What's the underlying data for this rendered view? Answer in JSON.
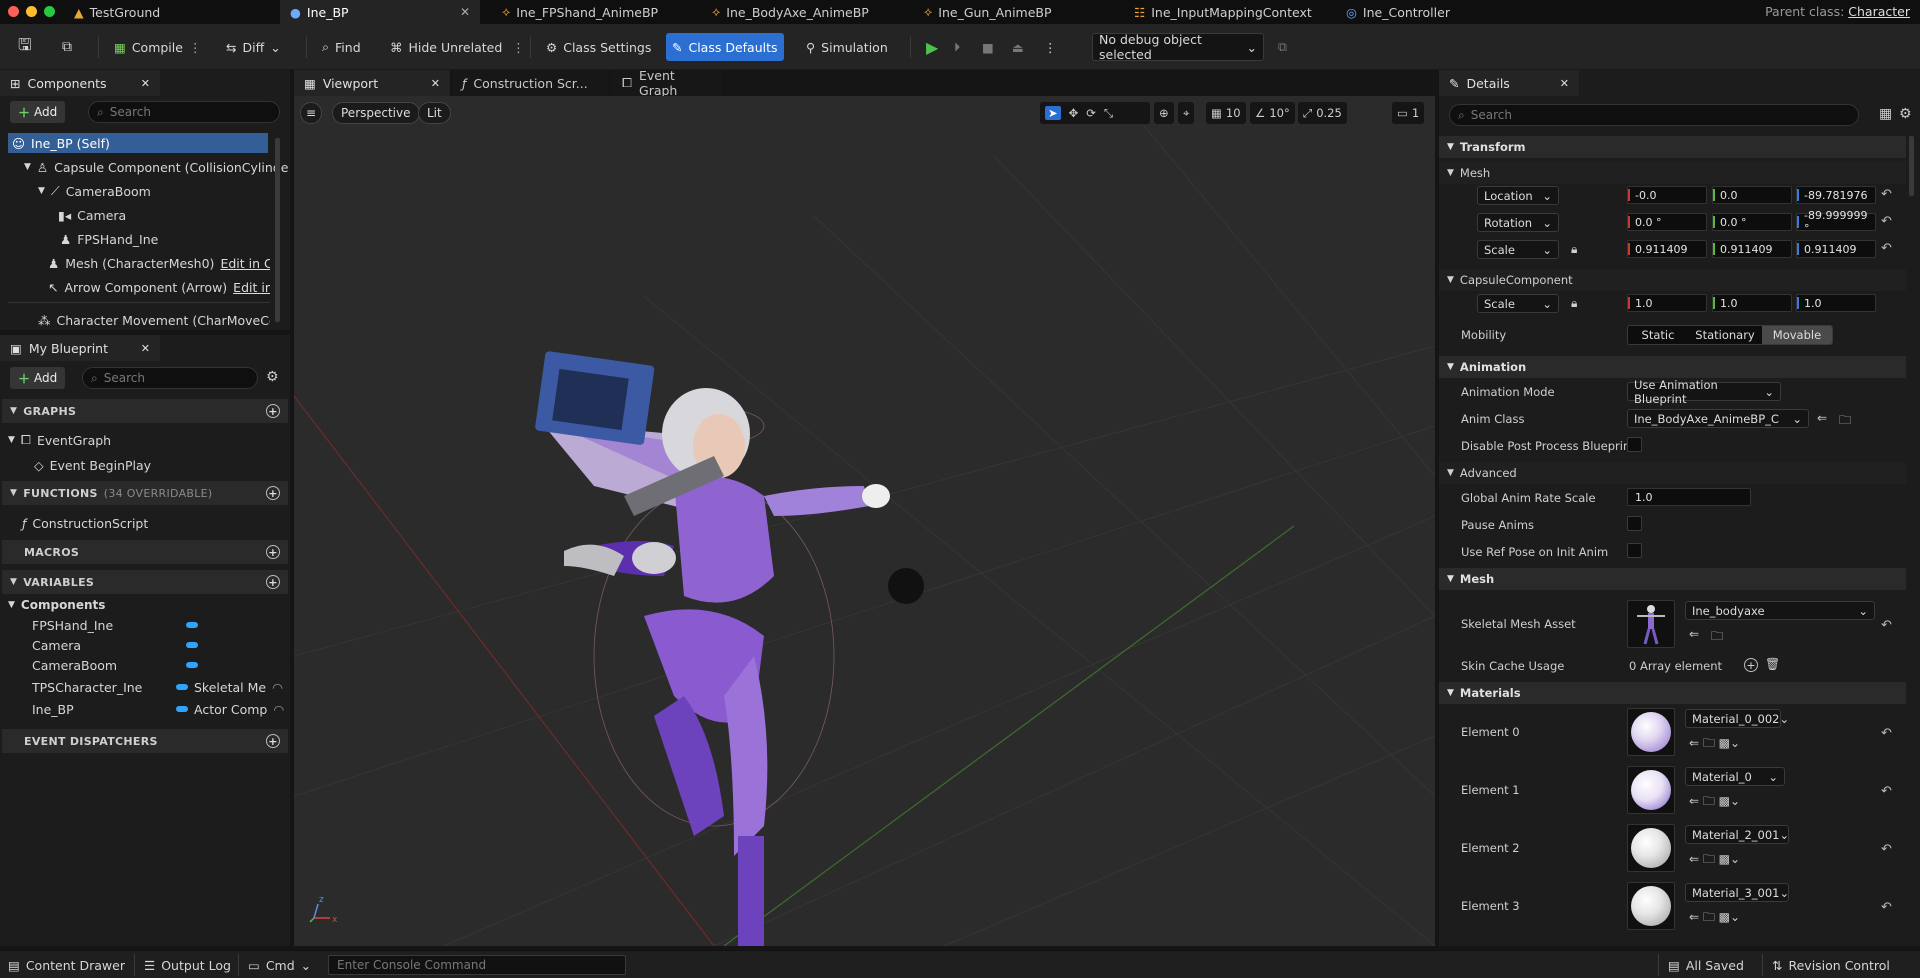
{
  "tabs": {
    "testground": "TestGround",
    "ine_bp": "Ine_BP",
    "fpshand": "Ine_FPShand_AnimeBP",
    "bodyaxe": "Ine_BodyAxe_AnimeBP",
    "gun": "Ine_Gun_AnimeBP",
    "input": "Ine_InputMappingContext",
    "controller": "Ine_Controller",
    "parent_label": "Parent class:",
    "parent_value": "Character"
  },
  "toolbar": {
    "compile": "Compile",
    "diff": "Diff",
    "find": "Find",
    "hide_unrelated": "Hide Unrelated",
    "class_settings": "Class Settings",
    "class_defaults": "Class Defaults",
    "simulation": "Simulation",
    "debug": "No debug object selected"
  },
  "components": {
    "title": "Components",
    "add": "Add",
    "search_placeholder": "Search",
    "items": [
      "Ine_BP (Self)",
      "Capsule Component (CollisionCylinde",
      "CameraBoom",
      "Camera",
      "FPSHand_Ine",
      "Mesh (CharacterMesh0)",
      "Arrow Component (Arrow)",
      "Character Movement (CharMoveCom"
    ],
    "edit_cpp": "Edit in C+",
    "edit_c": "Edit in C"
  },
  "myblueprint": {
    "title": "My Blueprint",
    "add": "Add",
    "search_placeholder": "Search",
    "graphs": "GRAPHS",
    "event_graph": "EventGraph",
    "begin_play": "Event BeginPlay",
    "functions": "FUNCTIONS",
    "functions_note": "(34 OVERRIDABLE)",
    "construction": "ConstructionScript",
    "macros": "MACROS",
    "variables": "VARIABLES",
    "components_cat": "Components",
    "vars": [
      {
        "name": "FPSHand_Ine",
        "type": ""
      },
      {
        "name": "Camera",
        "type": ""
      },
      {
        "name": "CameraBoom",
        "type": ""
      },
      {
        "name": "TPSCharacter_Ine",
        "type": "Skeletal Me"
      },
      {
        "name": "Ine_BP",
        "type": "Actor Comp"
      }
    ],
    "dispatchers": "EVENT DISPATCHERS"
  },
  "editor_tabs": {
    "viewport": "Viewport",
    "construction": "Construction Scr...",
    "event_graph": "Event Graph"
  },
  "viewport": {
    "perspective": "Perspective",
    "lit": "Lit",
    "grid": "10",
    "angle": "10°",
    "scale": "0.25",
    "cam": "1"
  },
  "details": {
    "title": "Details",
    "search_placeholder": "Search",
    "transform": "Transform",
    "mesh": "Mesh",
    "location": "Location",
    "rotation": "Rotation",
    "scale": "Scale",
    "loc": [
      "-0.0",
      "0.0",
      "-89.781976"
    ],
    "rot": [
      "0.0 °",
      "0.0 °",
      "-89.999999 °"
    ],
    "scl": [
      "0.911409",
      "0.911409",
      "0.911409"
    ],
    "capsule": "CapsuleComponent",
    "cap_scale": [
      "1.0",
      "1.0",
      "1.0"
    ],
    "mobility": "Mobility",
    "mob_static": "Static",
    "mob_stationary": "Stationary",
    "mob_movable": "Movable",
    "animation": "Animation",
    "anim_mode": "Animation Mode",
    "anim_mode_val": "Use Animation Blueprint",
    "anim_class": "Anim Class",
    "anim_class_val": "Ine_BodyAxe_AnimeBP_C",
    "disable_pp": "Disable Post Process Blueprin...",
    "advanced": "Advanced",
    "global_rate": "Global Anim Rate Scale",
    "global_rate_val": "1.0",
    "pause": "Pause Anims",
    "ref_pose": "Use Ref Pose on Init Anim",
    "mesh2": "Mesh",
    "skel_asset": "Skeletal Mesh Asset",
    "skel_val": "Ine_bodyaxe",
    "skin_cache": "Skin Cache Usage",
    "skin_cache_val": "0 Array element",
    "materials": "Materials",
    "elements": [
      {
        "label": "Element 0",
        "mat": "Material_0_002"
      },
      {
        "label": "Element 1",
        "mat": "Material_0"
      },
      {
        "label": "Element 2",
        "mat": "Material_2_001"
      },
      {
        "label": "Element 3",
        "mat": "Material_3_001"
      }
    ]
  },
  "status": {
    "content_drawer": "Content Drawer",
    "output_log": "Output Log",
    "cmd": "Cmd",
    "console_placeholder": "Enter Console Command",
    "all_saved": "All Saved",
    "revision": "Revision Control"
  }
}
